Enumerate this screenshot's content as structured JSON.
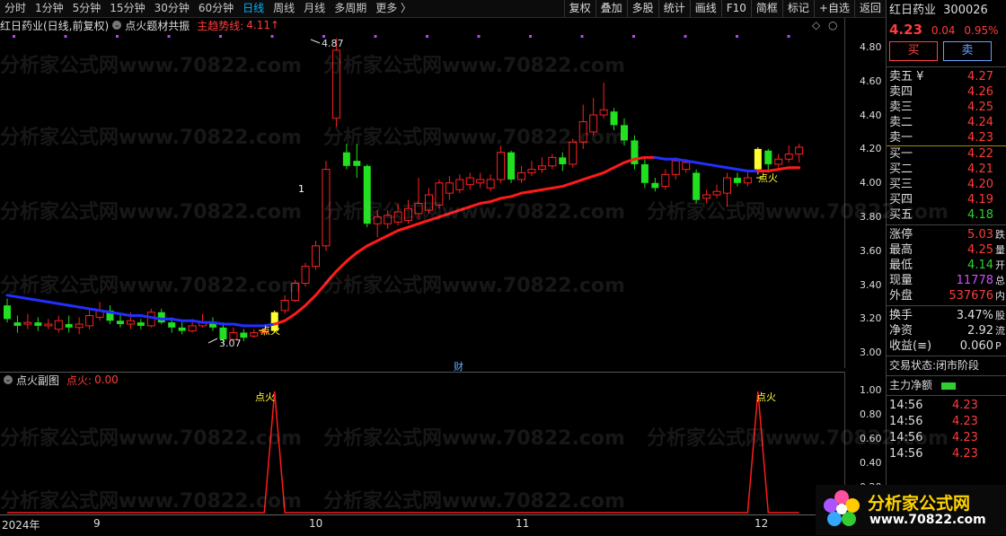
{
  "toolbar": {
    "periods": [
      "分时",
      "1分钟",
      "5分钟",
      "15分钟",
      "30分钟",
      "60分钟",
      "日线",
      "周线",
      "月线",
      "多周期",
      "更多 〉"
    ],
    "active_index": 6,
    "right_buttons": [
      "复权",
      "叠加",
      "多股",
      "统计",
      "画线",
      "F10",
      "简框",
      "标记",
      "+自选",
      "返回"
    ]
  },
  "info": {
    "stock": "红日药业(日线,前复权)",
    "indicator": "点火题材共振",
    "trend_label": "主趋势线:",
    "trend_value": "4.11",
    "trend_arrow": "↑"
  },
  "sub": {
    "name": "点火副图",
    "label": "点火:",
    "value": "0.00"
  },
  "main_axis": [
    "4.80",
    "4.60",
    "4.40",
    "4.20",
    "4.00",
    "3.80",
    "3.60",
    "3.40",
    "3.20",
    "3.00"
  ],
  "sub_axis": [
    "1.00",
    "0.80",
    "0.60",
    "0.40",
    "0.20"
  ],
  "annotations": {
    "high": "4.87",
    "low": "3.07",
    "fire": "点火",
    "marker_one": "1",
    "finance": "财"
  },
  "dates": [
    "2024年",
    "9",
    "10",
    "11",
    "12"
  ],
  "panel": {
    "name": "红日药业",
    "code": "300026",
    "price": "4.23",
    "change": "0.04",
    "pct": "0.95%",
    "buy_label": "买",
    "sell_label": "卖",
    "asks": [
      {
        "label": "卖五 ¥",
        "price": "4.27",
        "tail": ""
      },
      {
        "label": "卖四",
        "price": "4.26",
        "tail": ""
      },
      {
        "label": "卖三",
        "price": "4.25",
        "tail": ""
      },
      {
        "label": "卖二",
        "price": "4.24",
        "tail": ""
      },
      {
        "label": "卖一",
        "price": "4.23",
        "tail": ""
      }
    ],
    "bids": [
      {
        "label": "买一",
        "price": "4.22",
        "tail": ""
      },
      {
        "label": "买二",
        "price": "4.21",
        "tail": ""
      },
      {
        "label": "买三",
        "price": "4.20",
        "tail": ""
      },
      {
        "label": "买四",
        "price": "4.19",
        "tail": ""
      },
      {
        "label": "买五",
        "price": "4.18",
        "tail": ""
      }
    ],
    "stats": [
      {
        "label": "涨停",
        "value": "5.03",
        "cls": "red",
        "tail": "跌"
      },
      {
        "label": "最高",
        "value": "4.25",
        "cls": "red",
        "tail": "量"
      },
      {
        "label": "最低",
        "value": "4.14",
        "cls": "green",
        "tail": "开"
      },
      {
        "label": "现量",
        "value": "11778",
        "cls": "purple",
        "tail": "总"
      },
      {
        "label": "外盘",
        "value": "537676",
        "cls": "red",
        "tail": "内"
      }
    ],
    "stats2": [
      {
        "label": "换手",
        "value": "3.47%",
        "cls": "white",
        "tail": "股"
      },
      {
        "label": "净资",
        "value": "2.92",
        "cls": "white",
        "tail": "流"
      },
      {
        "label": "收益(≡)",
        "value": "0.060",
        "cls": "white",
        "tail": "P"
      }
    ],
    "trade_status_label": "交易状态:",
    "trade_status": "闭市阶段",
    "net_flow": "主力净额",
    "ticks": [
      {
        "time": "14:56",
        "price": "4.23"
      },
      {
        "time": "14:56",
        "price": "4.23"
      },
      {
        "time": "14:56",
        "price": "4.23"
      },
      {
        "time": "14:56",
        "price": "4.23"
      }
    ]
  },
  "logo": {
    "text": "分析家公式网",
    "url": "www.70822.com"
  },
  "watermark": "分析家公式网www.70822.com",
  "chart_data": {
    "type": "candlestick",
    "ylim": [
      3.0,
      4.9
    ],
    "candles": [
      [
        3.3,
        3.22,
        3.34,
        3.2
      ],
      [
        3.2,
        3.18,
        3.24,
        3.14
      ],
      [
        3.19,
        3.2,
        3.25,
        3.16
      ],
      [
        3.2,
        3.18,
        3.23,
        3.15
      ],
      [
        3.18,
        3.19,
        3.22,
        3.16
      ],
      [
        3.16,
        3.21,
        3.24,
        3.14
      ],
      [
        3.19,
        3.17,
        3.24,
        3.14
      ],
      [
        3.17,
        3.19,
        3.23,
        3.13
      ],
      [
        3.18,
        3.24,
        3.28,
        3.16
      ],
      [
        3.23,
        3.27,
        3.32,
        3.21
      ],
      [
        3.27,
        3.21,
        3.3,
        3.19
      ],
      [
        3.21,
        3.19,
        3.25,
        3.17
      ],
      [
        3.19,
        3.21,
        3.26,
        3.16
      ],
      [
        3.2,
        3.18,
        3.22,
        3.16
      ],
      [
        3.18,
        3.26,
        3.28,
        3.17
      ],
      [
        3.26,
        3.2,
        3.28,
        3.19
      ],
      [
        3.2,
        3.17,
        3.23,
        3.14
      ],
      [
        3.17,
        3.15,
        3.2,
        3.13
      ],
      [
        3.15,
        3.18,
        3.22,
        3.14
      ],
      [
        3.18,
        3.2,
        3.25,
        3.17
      ],
      [
        3.2,
        3.17,
        3.23,
        3.15
      ],
      [
        3.17,
        3.1,
        3.2,
        3.07
      ],
      [
        3.1,
        3.14,
        3.17,
        3.09
      ],
      [
        3.14,
        3.11,
        3.16,
        3.09
      ],
      [
        3.12,
        3.14,
        3.16,
        3.11
      ],
      [
        3.14,
        3.15,
        3.17,
        3.12
      ],
      [
        3.15,
        3.26,
        3.27,
        3.14
      ],
      [
        3.27,
        3.33,
        3.36,
        3.25
      ],
      [
        3.33,
        3.43,
        3.45,
        3.32
      ],
      [
        3.43,
        3.53,
        3.55,
        3.41
      ],
      [
        3.53,
        3.65,
        3.68,
        3.51
      ],
      [
        3.65,
        4.1,
        4.15,
        3.62
      ],
      [
        4.4,
        4.8,
        4.87,
        4.35
      ],
      [
        4.2,
        4.12,
        4.25,
        4.1
      ],
      [
        4.15,
        4.12,
        4.25,
        4.05
      ],
      [
        4.12,
        3.78,
        4.13,
        3.76
      ],
      [
        3.78,
        3.82,
        3.86,
        3.7
      ],
      [
        3.78,
        3.83,
        3.86,
        3.75
      ],
      [
        3.79,
        3.85,
        3.9,
        3.77
      ],
      [
        3.8,
        3.87,
        3.92,
        3.78
      ],
      [
        3.84,
        3.9,
        4.05,
        3.81
      ],
      [
        3.86,
        3.95,
        3.99,
        3.84
      ],
      [
        3.89,
        4.02,
        4.04,
        3.87
      ],
      [
        3.96,
        4.02,
        4.06,
        3.92
      ],
      [
        3.98,
        4.04,
        4.07,
        3.96
      ],
      [
        4.01,
        4.05,
        4.08,
        3.98
      ],
      [
        4.02,
        4.04,
        4.08,
        3.99
      ],
      [
        3.99,
        4.04,
        4.07,
        3.97
      ],
      [
        4.04,
        4.2,
        4.24,
        4.02
      ],
      [
        4.2,
        4.04,
        4.21,
        4.02
      ],
      [
        4.04,
        4.08,
        4.12,
        4.02
      ],
      [
        4.08,
        4.1,
        4.15,
        4.06
      ],
      [
        4.1,
        4.12,
        4.17,
        4.08
      ],
      [
        4.12,
        4.17,
        4.19,
        4.1
      ],
      [
        4.17,
        4.13,
        4.2,
        4.09
      ],
      [
        4.13,
        4.26,
        4.28,
        4.11
      ],
      [
        4.26,
        4.38,
        4.48,
        4.22
      ],
      [
        4.32,
        4.42,
        4.52,
        4.3
      ],
      [
        4.42,
        4.45,
        4.61,
        4.4
      ],
      [
        4.44,
        4.36,
        4.46,
        4.33
      ],
      [
        4.36,
        4.27,
        4.4,
        4.24
      ],
      [
        4.27,
        4.13,
        4.3,
        4.1
      ],
      [
        4.13,
        4.02,
        4.16,
        3.99
      ],
      [
        4.02,
        3.99,
        4.05,
        3.97
      ],
      [
        4.0,
        4.07,
        4.1,
        3.98
      ],
      [
        4.07,
        4.15,
        4.17,
        4.04
      ],
      [
        4.1,
        4.14,
        4.16,
        4.08
      ],
      [
        4.08,
        3.92,
        4.1,
        3.9
      ],
      [
        3.93,
        3.95,
        3.98,
        3.9
      ],
      [
        3.95,
        3.97,
        4.01,
        3.93
      ],
      [
        3.96,
        4.05,
        4.08,
        3.88
      ],
      [
        4.05,
        4.02,
        4.08,
        4.0
      ],
      [
        4.02,
        4.05,
        4.08,
        4.0
      ],
      [
        4.1,
        4.22,
        4.23,
        4.07
      ],
      [
        4.21,
        4.13,
        4.22,
        4.08
      ],
      [
        4.13,
        4.16,
        4.19,
        4.11
      ],
      [
        4.16,
        4.19,
        4.24,
        4.14
      ],
      [
        4.19,
        4.23,
        4.25,
        4.14
      ]
    ],
    "trend_line": [
      3.36,
      3.35,
      3.34,
      3.33,
      3.32,
      3.31,
      3.3,
      3.29,
      3.28,
      3.27,
      3.26,
      3.25,
      3.24,
      3.24,
      3.23,
      3.22,
      3.22,
      3.21,
      3.21,
      3.2,
      3.2,
      3.19,
      3.19,
      3.18,
      3.18,
      3.18,
      3.19,
      3.21,
      3.25,
      3.3,
      3.36,
      3.43,
      3.5,
      3.56,
      3.61,
      3.65,
      3.68,
      3.71,
      3.74,
      3.76,
      3.78,
      3.8,
      3.82,
      3.84,
      3.86,
      3.88,
      3.9,
      3.91,
      3.93,
      3.94,
      3.96,
      3.97,
      3.98,
      3.99,
      4.0,
      4.02,
      4.04,
      4.06,
      4.08,
      4.11,
      4.14,
      4.16,
      4.17,
      4.17,
      4.16,
      4.16,
      4.15,
      4.14,
      4.13,
      4.12,
      4.11,
      4.1,
      4.09,
      4.09,
      4.09,
      4.1,
      4.11,
      4.11
    ],
    "signal": [
      0,
      0,
      0,
      0,
      0,
      0,
      0,
      0,
      0,
      0,
      0,
      0,
      0,
      0,
      0,
      0,
      0,
      0,
      0,
      0,
      0,
      0,
      0,
      0,
      0,
      0,
      1,
      0,
      0,
      0,
      0,
      0,
      0,
      0,
      0,
      0,
      0,
      0,
      0,
      0,
      0,
      0,
      0,
      0,
      0,
      0,
      0,
      0,
      0,
      0,
      0,
      0,
      0,
      0,
      0,
      0,
      0,
      0,
      0,
      0,
      0,
      0,
      0,
      0,
      0,
      0,
      0,
      0,
      0,
      0,
      0,
      0,
      0,
      1,
      0,
      0,
      0,
      0
    ]
  }
}
